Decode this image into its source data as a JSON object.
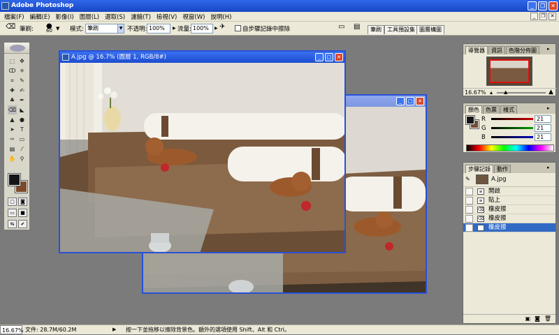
{
  "app": {
    "title": "Adobe Photoshop"
  },
  "menu": [
    "檔案(F)",
    "編輯(E)",
    "影像(I)",
    "圖層(L)",
    "選取(S)",
    "濾鏡(T)",
    "檢視(V)",
    "視窗(W)",
    "說明(H)"
  ],
  "options": {
    "brush_label": "筆刷:",
    "brush_size": "60",
    "mode_label": "模式:",
    "mode_value": "筆刷",
    "opacity_label": "不透明:",
    "opacity_value": "100%",
    "flow_label": "流量:",
    "flow_value": "100%",
    "history_checkbox_label": "自步驟記錄中擦除",
    "well_tabs": [
      "筆刷",
      "工具預設集",
      "圖層構圖"
    ]
  },
  "documents": {
    "front_title": "A.jpg @ 16.7% (圖層 1, RGB/8#)"
  },
  "navigator": {
    "tabs": [
      "導覽器",
      "資訊",
      "色階分佈圖"
    ],
    "zoom": "16.67%"
  },
  "color_panel": {
    "tabs": [
      "顏色",
      "色票",
      "樣式"
    ],
    "channels": [
      {
        "label": "R",
        "value": "21",
        "color": "#d00000"
      },
      {
        "label": "G",
        "value": "21",
        "color": "#00a000"
      },
      {
        "label": "B",
        "value": "21",
        "color": "#0000c0"
      }
    ]
  },
  "history_panel": {
    "tabs": [
      "步驟記錄",
      "動作"
    ],
    "snapshot": "A.jpg",
    "items": [
      {
        "label": "開啟",
        "selected": false
      },
      {
        "label": "貼上",
        "selected": false
      },
      {
        "label": "橡皮擦",
        "selected": false
      },
      {
        "label": "橡皮擦",
        "selected": false
      },
      {
        "label": "橡皮擦",
        "selected": true
      }
    ]
  },
  "status": {
    "zoom": "16.67%",
    "doc_info": "文件: 28.7M/60.2M",
    "hint": "按一下並拖移以擦除背景色。額外的選項使用 Shift、Alt 和 Ctrl。"
  }
}
